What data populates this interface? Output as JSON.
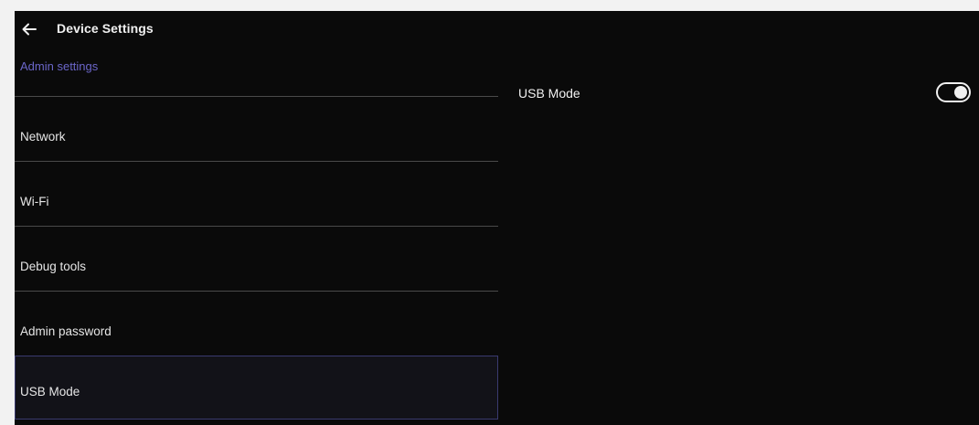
{
  "header": {
    "title": "Device Settings",
    "back_icon": "arrow-left-icon"
  },
  "section": {
    "label": "Admin settings",
    "label_color": "#6b66c9"
  },
  "menu": {
    "items": [
      {
        "label": "Network",
        "selected": false
      },
      {
        "label": "Wi-Fi",
        "selected": false
      },
      {
        "label": "Debug tools",
        "selected": false
      },
      {
        "label": "Admin password",
        "selected": false
      },
      {
        "label": "USB Mode",
        "selected": true
      }
    ]
  },
  "detail": {
    "setting_label": "USB Mode",
    "toggle_state": "on",
    "toggle_icon": "toggle-switch-icon"
  },
  "colors": {
    "background": "#0a0a0a",
    "text": "#f0f0f0",
    "divider": "#4a4a4a",
    "selected_border": "#3a3a70"
  }
}
